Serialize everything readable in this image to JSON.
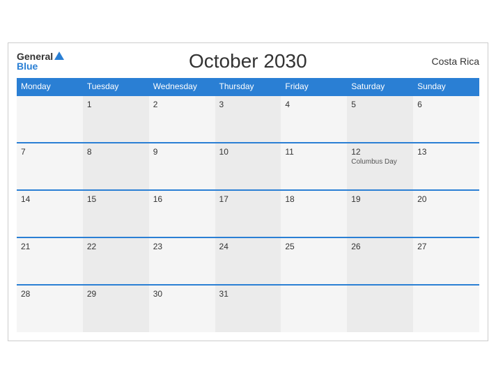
{
  "header": {
    "logo_general": "General",
    "logo_blue": "Blue",
    "title": "October 2030",
    "country": "Costa Rica"
  },
  "weekdays": [
    "Monday",
    "Tuesday",
    "Wednesday",
    "Thursday",
    "Friday",
    "Saturday",
    "Sunday"
  ],
  "weeks": [
    [
      {
        "day": "",
        "event": ""
      },
      {
        "day": "1",
        "event": ""
      },
      {
        "day": "2",
        "event": ""
      },
      {
        "day": "3",
        "event": ""
      },
      {
        "day": "4",
        "event": ""
      },
      {
        "day": "5",
        "event": ""
      },
      {
        "day": "6",
        "event": ""
      }
    ],
    [
      {
        "day": "7",
        "event": ""
      },
      {
        "day": "8",
        "event": ""
      },
      {
        "day": "9",
        "event": ""
      },
      {
        "day": "10",
        "event": ""
      },
      {
        "day": "11",
        "event": ""
      },
      {
        "day": "12",
        "event": "Columbus Day"
      },
      {
        "day": "13",
        "event": ""
      }
    ],
    [
      {
        "day": "14",
        "event": ""
      },
      {
        "day": "15",
        "event": ""
      },
      {
        "day": "16",
        "event": ""
      },
      {
        "day": "17",
        "event": ""
      },
      {
        "day": "18",
        "event": ""
      },
      {
        "day": "19",
        "event": ""
      },
      {
        "day": "20",
        "event": ""
      }
    ],
    [
      {
        "day": "21",
        "event": ""
      },
      {
        "day": "22",
        "event": ""
      },
      {
        "day": "23",
        "event": ""
      },
      {
        "day": "24",
        "event": ""
      },
      {
        "day": "25",
        "event": ""
      },
      {
        "day": "26",
        "event": ""
      },
      {
        "day": "27",
        "event": ""
      }
    ],
    [
      {
        "day": "28",
        "event": ""
      },
      {
        "day": "29",
        "event": ""
      },
      {
        "day": "30",
        "event": ""
      },
      {
        "day": "31",
        "event": ""
      },
      {
        "day": "",
        "event": ""
      },
      {
        "day": "",
        "event": ""
      },
      {
        "day": "",
        "event": ""
      }
    ]
  ]
}
